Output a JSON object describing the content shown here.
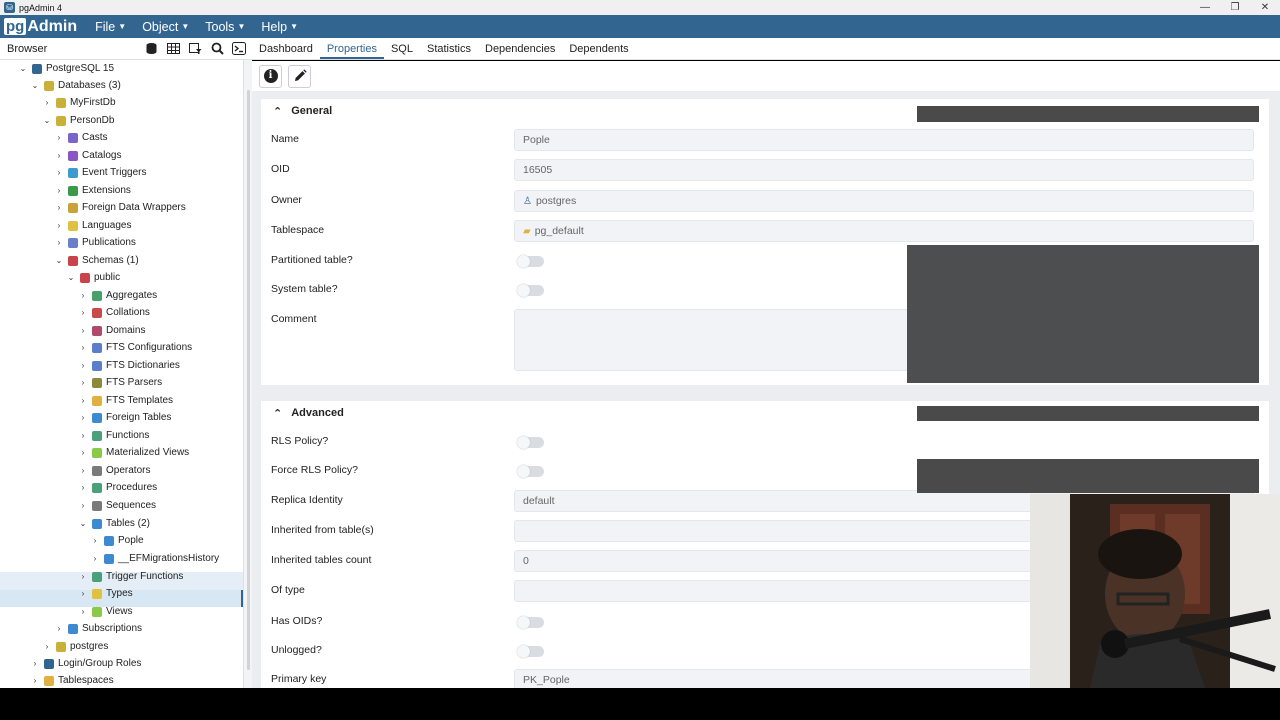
{
  "window": {
    "title": "pgAdmin 4",
    "controls": [
      "—",
      "❐",
      "✕"
    ]
  },
  "menubar": {
    "logo_pg": "pg",
    "logo_admin": "Admin",
    "items": [
      "File",
      "Object",
      "Tools",
      "Help"
    ]
  },
  "browser": {
    "label": "Browser",
    "tree": [
      {
        "label": "PostgreSQL 15",
        "icon": "elephant-icon",
        "color": "#326690",
        "chev": "v"
      },
      {
        "label": "Databases (3)",
        "icon": "database-icon",
        "color": "#c9b03a",
        "chev": "v"
      },
      {
        "label": "MyFirstDb",
        "icon": "database-icon",
        "color": "#c9b03a",
        "chev": ">"
      },
      {
        "label": "PersonDb",
        "icon": "database-icon",
        "color": "#c9b03a",
        "chev": "v"
      },
      {
        "label": "Casts",
        "icon": "cast-icon",
        "color": "#7a63c9",
        "chev": ">"
      },
      {
        "label": "Catalogs",
        "icon": "catalog-icon",
        "color": "#8a56c2",
        "chev": ">"
      },
      {
        "label": "Event Triggers",
        "icon": "event-trigger-icon",
        "color": "#3d9ad1",
        "chev": ">"
      },
      {
        "label": "Extensions",
        "icon": "extension-icon",
        "color": "#3a9a4a",
        "chev": ">"
      },
      {
        "label": "Foreign Data Wrappers",
        "icon": "fdw-icon",
        "color": "#c9a23a",
        "chev": ">"
      },
      {
        "label": "Languages",
        "icon": "language-icon",
        "color": "#e0c040",
        "chev": ">"
      },
      {
        "label": "Publications",
        "icon": "publication-icon",
        "color": "#6a7ec9",
        "chev": ">"
      },
      {
        "label": "Schemas (1)",
        "icon": "schema-icon",
        "color": "#c9434a",
        "chev": "v"
      },
      {
        "label": "public",
        "icon": "schema-public-icon",
        "color": "#c9434a",
        "chev": "v"
      },
      {
        "label": "Aggregates",
        "icon": "aggregate-icon",
        "color": "#4aa06a",
        "chev": ">"
      },
      {
        "label": "Collations",
        "icon": "collation-icon",
        "color": "#c94a4a",
        "chev": ">"
      },
      {
        "label": "Domains",
        "icon": "domain-icon",
        "color": "#b04a6a",
        "chev": ">"
      },
      {
        "label": "FTS Configurations",
        "icon": "fts-config-icon",
        "color": "#5a7ec9",
        "chev": ">"
      },
      {
        "label": "FTS Dictionaries",
        "icon": "fts-dictionary-icon",
        "color": "#5a7ec9",
        "chev": ">"
      },
      {
        "label": "FTS Parsers",
        "icon": "fts-parser-icon",
        "color": "#8a8a3a",
        "chev": ">"
      },
      {
        "label": "FTS Templates",
        "icon": "fts-template-icon",
        "color": "#e0b040",
        "chev": ">"
      },
      {
        "label": "Foreign Tables",
        "icon": "foreign-table-icon",
        "color": "#3d8ad1",
        "chev": ">"
      },
      {
        "label": "Functions",
        "icon": "function-icon",
        "color": "#4aa07a",
        "chev": ">"
      },
      {
        "label": "Materialized Views",
        "icon": "materialized-view-icon",
        "color": "#8ac94a",
        "chev": ">"
      },
      {
        "label": "Operators",
        "icon": "operator-icon",
        "color": "#7a7a7a",
        "chev": ">"
      },
      {
        "label": "Procedures",
        "icon": "procedure-icon",
        "color": "#4aa07a",
        "chev": ">"
      },
      {
        "label": "Sequences",
        "icon": "sequence-icon",
        "color": "#7a7a7a",
        "chev": ">"
      },
      {
        "label": "Tables (2)",
        "icon": "tables-icon",
        "color": "#3d8ad1",
        "chev": "v"
      },
      {
        "label": "Pople",
        "icon": "table-icon",
        "color": "#3d8ad1",
        "chev": ">"
      },
      {
        "label": "__EFMigrationsHistory",
        "icon": "table-icon",
        "color": "#3d8ad1",
        "chev": ">"
      },
      {
        "label": "Trigger Functions",
        "icon": "trigger-function-icon",
        "color": "#4aa07a",
        "chev": ">"
      },
      {
        "label": "Types",
        "icon": "type-icon",
        "color": "#e0c040",
        "chev": ">"
      },
      {
        "label": "Views",
        "icon": "view-icon",
        "color": "#8ac94a",
        "chev": ">"
      },
      {
        "label": "Subscriptions",
        "icon": "subscription-icon",
        "color": "#3d8ad1",
        "chev": ">"
      },
      {
        "label": "postgres",
        "icon": "database-icon",
        "color": "#c9b03a",
        "chev": ">"
      },
      {
        "label": "Login/Group Roles",
        "icon": "login-roles-icon",
        "color": "#326690",
        "chev": ">"
      },
      {
        "label": "Tablespaces",
        "icon": "tablespace-icon",
        "color": "#e0b040",
        "chev": ">"
      }
    ]
  },
  "tabs": [
    "Dashboard",
    "Properties",
    "SQL",
    "Statistics",
    "Dependencies",
    "Dependents"
  ],
  "active_tab": "Properties",
  "general": {
    "title": "General",
    "name_label": "Name",
    "name_value": "Pople",
    "oid_label": "OID",
    "oid_value": "16505",
    "owner_label": "Owner",
    "owner_value": "postgres",
    "tablespace_label": "Tablespace",
    "tablespace_value": "pg_default",
    "partitioned_label": "Partitioned table?",
    "system_label": "System table?",
    "comment_label": "Comment"
  },
  "advanced": {
    "title": "Advanced",
    "rls_label": "RLS Policy?",
    "force_rls_label": "Force RLS Policy?",
    "replica_label": "Replica Identity",
    "replica_value": "default",
    "inherited_label": "Inherited from table(s)",
    "inherited_value": "",
    "inherited_count_label": "Inherited tables count",
    "inherited_count_value": "0",
    "of_type_label": "Of type",
    "of_type_value": "",
    "has_oids_label": "Has OIDs?",
    "unlogged_label": "Unlogged?",
    "pk_label": "Primary key",
    "pk_value": "PK_Pople"
  }
}
